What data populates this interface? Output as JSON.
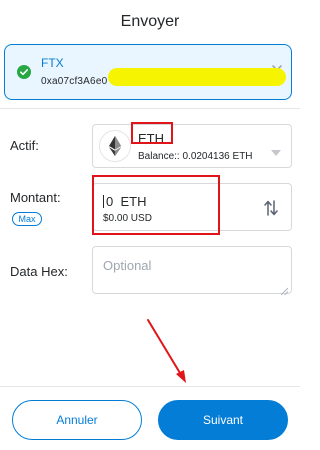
{
  "header": {
    "title": "Envoyer"
  },
  "recipient": {
    "name": "FTX",
    "address": "0xa07cf3A6e0",
    "icons": {
      "status": "check-circle-icon",
      "clear": "close-icon"
    }
  },
  "asset": {
    "label": "Actif:",
    "symbol": "ETH",
    "balance": "Balance:: 0.0204136 ETH",
    "icons": {
      "logo": "ethereum-logo-icon",
      "dropdown": "chevron-down-icon"
    }
  },
  "amount": {
    "label": "Montant:",
    "max_label": "Max",
    "value": "0",
    "unit": "ETH",
    "fiat": "$0.00 USD",
    "icons": {
      "swap": "swap-vertical-icon"
    }
  },
  "data_hex": {
    "label": "Data Hex:",
    "placeholder": "Optional"
  },
  "footer": {
    "cancel_label": "Annuler",
    "next_label": "Suivant"
  },
  "colors": {
    "accent": "#037dd6",
    "success": "#28a745",
    "annotation": "#e0151a",
    "highlight": "#f6f400"
  }
}
